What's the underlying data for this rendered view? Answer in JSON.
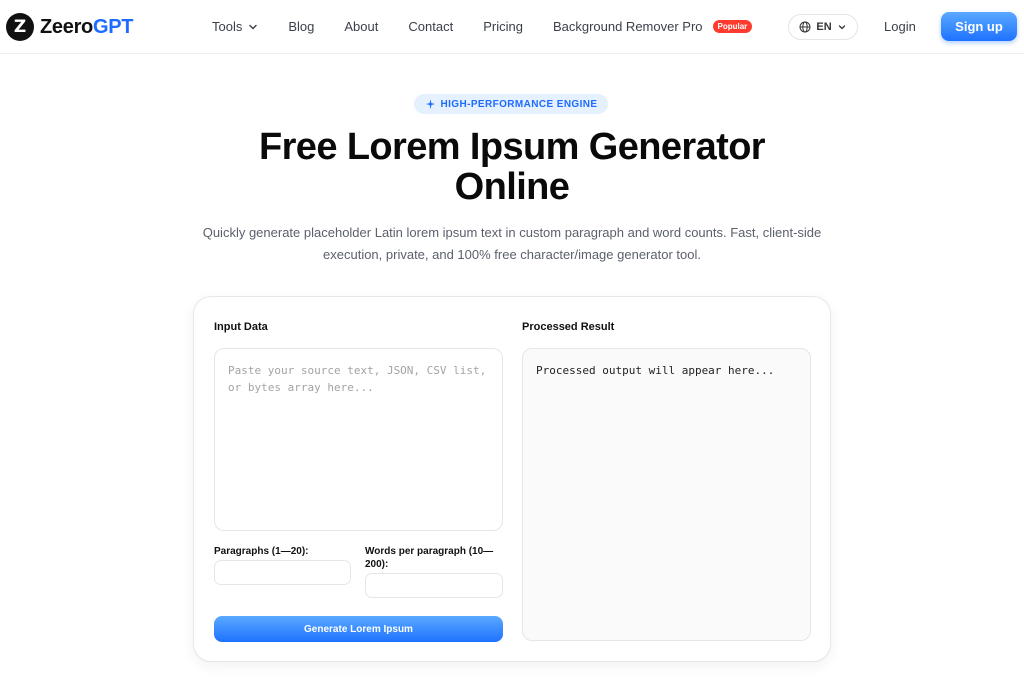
{
  "header": {
    "logo_letter": "Z",
    "logo_main": "Zeero",
    "logo_accent": "GPT",
    "nav": [
      {
        "label": "Tools"
      },
      {
        "label": "Blog"
      },
      {
        "label": "About"
      },
      {
        "label": "Contact"
      },
      {
        "label": "Pricing"
      },
      {
        "label": "Background Remover Pro",
        "badge": "Popular"
      }
    ],
    "language": "EN",
    "login_label": "Login",
    "signup_label": "Sign up"
  },
  "hero": {
    "pill": "HIGH-PERFORMANCE ENGINE",
    "title_line1": "Free Lorem Ipsum Generator",
    "title_line2": "Online",
    "subtitle_line1": "Quickly generate placeholder Latin lorem ipsum text in custom paragraph and word counts. Fast, client-side",
    "subtitle_line2": "execution, private, and 100% free character/image generator tool."
  },
  "tool": {
    "input_label": "Input Data",
    "input_placeholder": "Paste your source text, JSON, CSV list, or bytes array here...",
    "input_value": "",
    "output_label": "Processed Result",
    "output_text": "Processed output will appear here...",
    "paragraphs_label": "Paragraphs (1—20):",
    "paragraphs_value": "",
    "words_label_line1": "Words per paragraph (10—",
    "words_label_line2": "200):",
    "words_value": "",
    "generate_label": "Generate Lorem Ipsum"
  },
  "colors": {
    "accent": "#1e6bff",
    "popular_badge": "#ff3b30",
    "pill_bg": "#e6f1ff"
  }
}
